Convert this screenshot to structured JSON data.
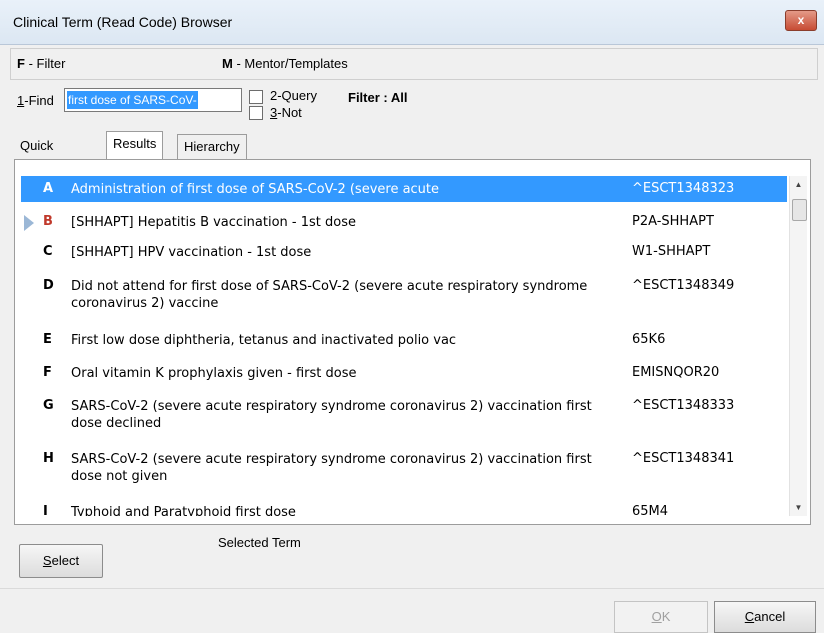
{
  "window": {
    "title": "Clinical Term (Read Code) Browser",
    "close_glyph": "x"
  },
  "shortcuts": {
    "filter_key": "F",
    "filter_label": " - Filter",
    "mentor_key": "M",
    "mentor_label": " - Mentor/Templates"
  },
  "find": {
    "label_prefix": "1",
    "label_rest": "-Find",
    "value": "first dose of SARS-CoV-",
    "query_label": "2-Query",
    "not_prefix": "3",
    "not_rest": "-Not",
    "filter_status": "Filter : All"
  },
  "tabs": [
    {
      "label": "Quick Keys"
    },
    {
      "label": "Results"
    },
    {
      "label": "Hierarchy"
    }
  ],
  "results": [
    {
      "letter": "A",
      "term": "Administration of first dose of SARS-CoV-2 (severe acute",
      "code": "^ESCT1348323"
    },
    {
      "letter": "B",
      "term": "[SHHAPT] Hepatitis B vaccination - 1st dose",
      "code": "P2A-SHHAPT"
    },
    {
      "letter": "C",
      "term": "[SHHAPT] HPV vaccination - 1st dose",
      "code": "W1-SHHAPT"
    },
    {
      "letter": "D",
      "term": "Did not attend for first dose of SARS-CoV-2 (severe acute respiratory syndrome coronavirus 2) vaccine",
      "code": "^ESCT1348349"
    },
    {
      "letter": "E",
      "term": "First low dose diphtheria, tetanus and inactivated polio vac",
      "code": "65K6"
    },
    {
      "letter": "F",
      "term": "Oral vitamin K prophylaxis given - first dose",
      "code": "EMISNQOR20"
    },
    {
      "letter": "G",
      "term": "SARS-CoV-2 (severe acute respiratory syndrome coronavirus 2) vaccination first dose declined",
      "code": "^ESCT1348333"
    },
    {
      "letter": "H",
      "term": "SARS-CoV-2 (severe acute respiratory syndrome coronavirus 2) vaccination first dose not given",
      "code": "^ESCT1348341"
    },
    {
      "letter": "I",
      "term": "Typhoid and Paratyphoid first dose",
      "code": "65M4"
    }
  ],
  "bottom": {
    "select_underlined": "S",
    "select_rest": "elect",
    "selected_term_label": "Selected Term",
    "ok_underlined": "O",
    "ok_rest": "K",
    "cancel_underlined": "C",
    "cancel_rest": "ancel"
  },
  "colors": {
    "selection": "#3399ff",
    "close_button": "#c74c34",
    "active_letter": "#c0392b"
  }
}
